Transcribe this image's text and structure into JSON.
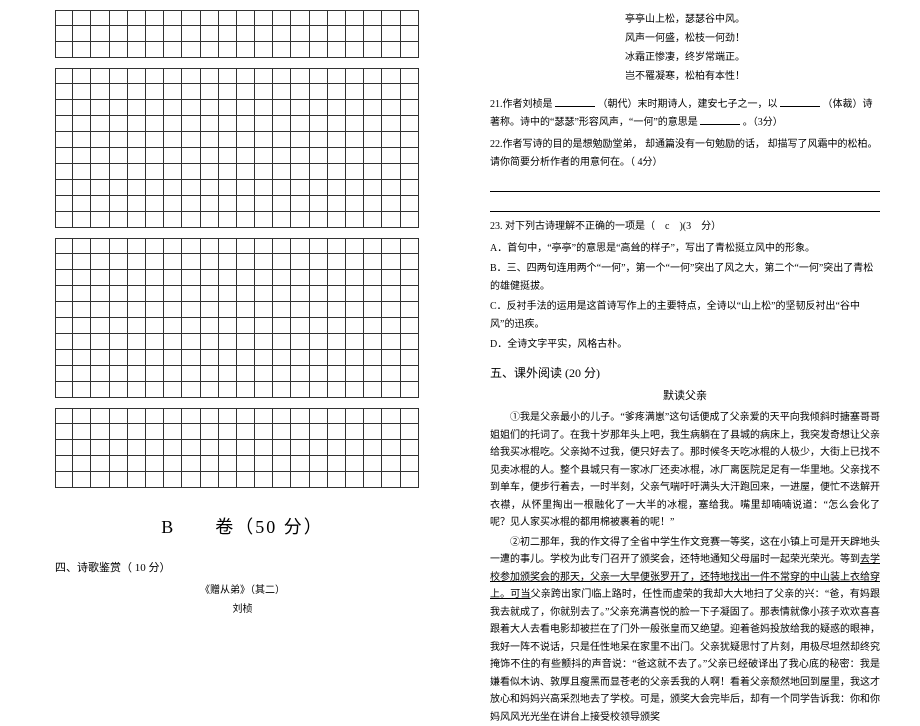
{
  "big_title": "B　　卷（50 分）",
  "sec4_head": "四、诗歌鉴赏（ 10 分）",
  "poem_title": "《赠从弟》（其二）",
  "poem_author": "刘桢",
  "poem_l1": "亭亭山上松，瑟瑟谷中风。",
  "poem_l2": "风声一何盛，松枝一何劲！",
  "poem_l3": "冰霜正惨凄，终岁常端正。",
  "poem_l4": "岂不罹凝寒，松柏有本性！",
  "q21_a": "21.作者刘桢是 ",
  "q21_b": "（朝代）末时期诗人，建安七子之一，以 ",
  "q21_c": "（体裁）诗著称。诗中的“瑟瑟”形容风声，“一何”的意思是 ",
  "q21_d": "。（3分）",
  "q22_a": "22.作者写诗的目的是想勉励堂弟，",
  "q22_b": "却通篇没有一句勉励的话，",
  "q22_c": "却描写了风霜中的松柏。",
  "q22_d": "请你简要分析作者的用意何在。（ 4分）",
  "q23_head": "23. 对下列古诗理解不正确的一项是（　c　)(3　分）",
  "optA": "A．首句中，“亭亭”的意思是“高耸的样子”，写出了青松挺立风中的形象。",
  "optB": "B．三、四两句连用两个“一何”，第一个“一何”突出了风之大，第二个“一何”突出了青松的雄健挺拔。",
  "optC": "C．反衬手法的运用是这首诗写作上的主要特点，全诗以“山上松”的坚韧反衬出“谷中风”的迅疾。",
  "optD": "D．全诗文字平实，风格古朴。",
  "sec5_head": "五、课外阅读 (20 分)",
  "essay_title": "默读父亲",
  "p1": "①我是父亲最小的儿子。“爹疼满崽”这句话便成了父亲爱的天平向我倾斜时搪塞哥哥姐姐们的托词了。在我十岁那年头上吧，我生病躺在了县城的病床上，我突发奇想让父亲给我买冰棍吃。父亲拗不过我，便只好去了。那时候冬天吃冰棍的人极少，大街上已找不见卖冰棍的人。整个县城只有一家冰厂还卖冰棍，冰厂离医院足足有一华里地。父亲找不到单车，便步行着去，一时半刻，父亲气喘吁吁满头大汗跑回来，一进屋，便忙不迭解开衣襟，从怀里掏出一根融化了一大半的冰棍，塞给我。嘴里却喃喃说道：“怎么会化了呢？见人家买冰棍的都用棉被裹着的呢！”",
  "p2a": "②初二那年，我的作文得了全省中学生作文竞赛一等奖，这在小镇上可是开天辟地头一遭的事儿。学校为此专门召开了颁奖会，还特地通知父母届时一起荣光荣光。等到",
  "p2u": "去学校参加颁奖会的那天，父亲一大早便张罗开了，还特地找出一件不常穿的中山装上衣给穿上。可当",
  "p2b": "父亲跨出家门临上路时，任性而虚荣的我却大大地扫了父亲的兴：“爸，有妈跟我去就成了，你就别去了。”父亲充满喜悦的脸一下子凝固了。那表情就像小孩子欢欢喜喜跟着大人去看电影却被拦在了门外一般张皇而又绝望。迎着爸妈投放给我的疑惑的眼神，我好一阵不说话，只是任性地呆在家里不出门。父亲犹疑思忖了片刻，用极尽坦然却终究掩饰不住的有些颤抖的声音说：“爸这就不去了。”父亲已经破译出了我心底的秘密：我是嫌看似木讷、敦厚且瘦黑而显苍老的父亲丢我的人啊！看着父亲颓然地回到屋里，我这才放心和妈妈兴高采烈地去了学校。可是，颁奖大会完毕后，却有一个同学告诉我：你和你妈风风光光坐在讲台上接受校领导颁奖"
}
